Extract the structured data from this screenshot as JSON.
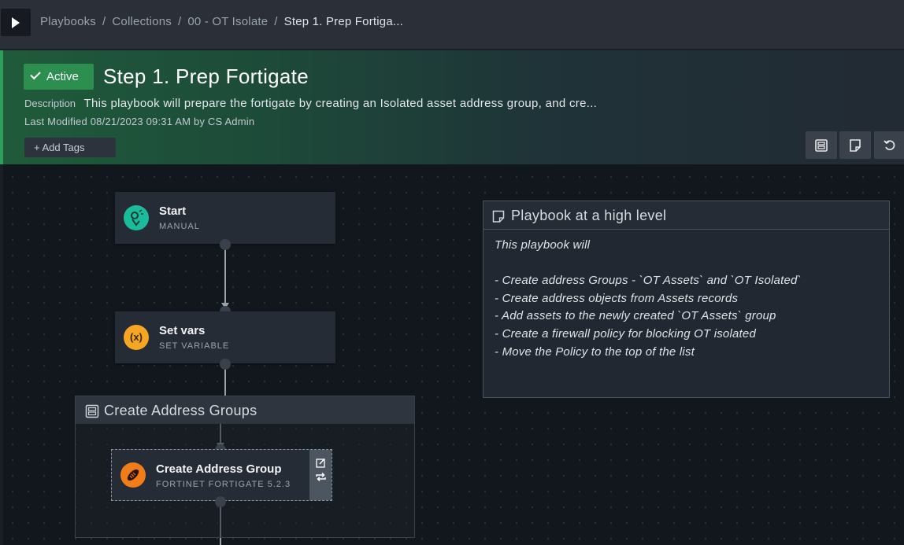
{
  "breadcrumb": {
    "items": [
      "Playbooks",
      "Collections",
      "00 - OT Isolate"
    ],
    "current": "Step 1. Prep Fortiga...",
    "separator": "/"
  },
  "header": {
    "status": "Active",
    "title": "Step 1. Prep Fortigate",
    "description_label": "Description",
    "description": "This playbook will prepare the fortigate by creating an Isolated asset address group, and cre...",
    "last_modified": "Last Modified 08/21/2023 09:31 AM by CS Admin",
    "add_tags": "+ Add Tags",
    "accent_color": "#2f9e5c"
  },
  "canvas": {
    "nodes": [
      {
        "name": "Start",
        "type": "MANUAL",
        "icon": "start-icon",
        "icon_color": "#1abc9c"
      },
      {
        "name": "Set vars",
        "type": "SET VARIABLE",
        "icon": "variable-icon",
        "icon_color": "#f5a623",
        "icon_text": "(x)"
      }
    ],
    "group": {
      "title": "Create Address Groups",
      "action": {
        "name": "Create Address Group",
        "type": "FORTINET FORTIGATE 5.2.3",
        "icon": "fortinet-icon",
        "icon_color": "#f07c1a"
      }
    },
    "note": {
      "title": "Playbook at a high level",
      "lines": [
        "This playbook will",
        "",
        "- Create address Groups - `OT Assets` and `OT Isolated`",
        "- Create address objects from Assets records",
        "- Add assets to the newly created `OT Assets` group",
        "- Create a firewall policy for blocking OT isolated",
        "- Move the Policy to the top of the list"
      ]
    }
  }
}
